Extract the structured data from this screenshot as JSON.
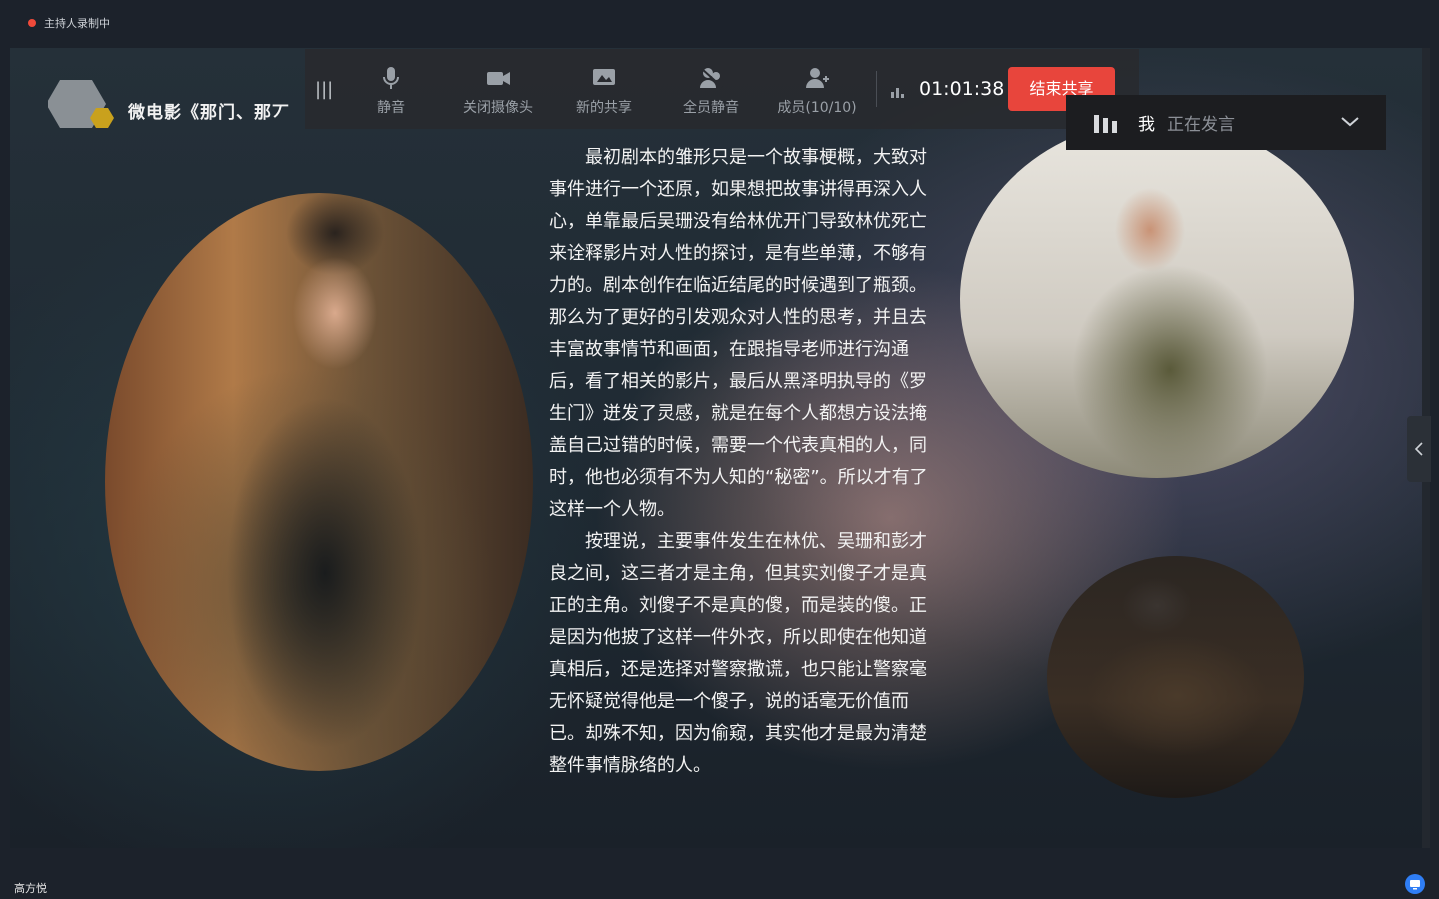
{
  "recording": {
    "label": "主持人录制中",
    "dot_color": "#f04a3a"
  },
  "slide": {
    "title": "微电影《那门、那丆",
    "paragraph_1": "最初剧本的雏形只是一个故事梗概，大致对事件进行一个还原，如果想把故事讲得再深入人心，单靠最后吴珊没有给林优开门导致林优死亡来诠释影片对人性的探讨，是有些单薄，不够有力的。剧本创作在临近结尾的时候遇到了瓶颈。那么为了更好的引发观众对人性的思考，并且去丰富故事情节和画面，在跟指导老师进行沟通后，看了相关的影片，最后从黑泽明执导的《罗生门》迸发了灵感，就是在每个人都想方设法掩盖自己过错的时候，需要一个代表真相的人，同时，他也必须有不为人知的“秘密”。所以才有了这样一个人物。",
    "paragraph_2": "按理说，主要事件发生在林优、吴珊和彭才良之间，这三者才是主角，但其实刘傻子才是真正的主角。刘傻子不是真的傻，而是装的傻。正是因为他披了这样一件外衣，所以即使在他知道真相后，还是选择对警察撒谎，也只能让警察毫无怀疑觉得他是一个傻子，说的话毫无价值而已。却殊不知，因为偷窥，其实他才是最为清楚整件事情脉络的人。"
  },
  "toolbar": {
    "mute_label": "静音",
    "camera_label": "关闭摄像头",
    "share_label": "新的共享",
    "mute_all_label": "全员静音",
    "members_label": "成员(10/10)",
    "timer": "01:01:38",
    "end_share_label": "结束共享",
    "end_color": "#e8453c"
  },
  "speaker": {
    "name": "我",
    "status": "正在发言"
  },
  "footer": {
    "user_name": "高方悦"
  }
}
